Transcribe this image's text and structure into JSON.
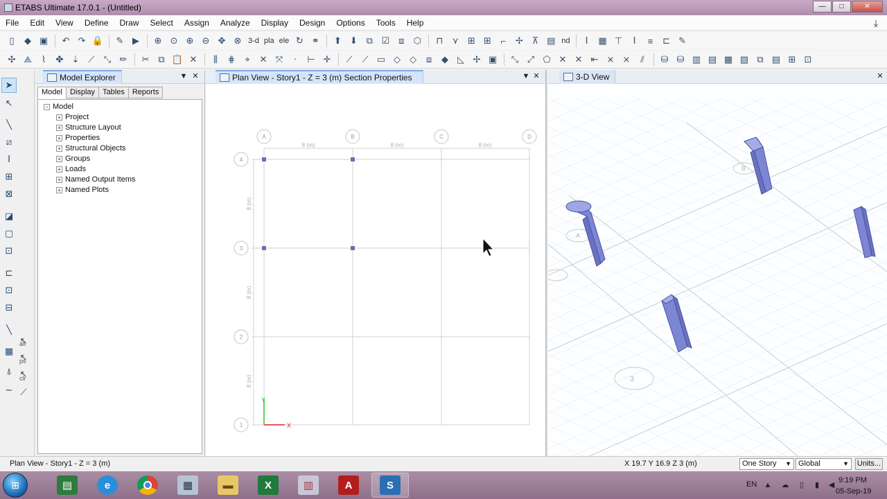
{
  "window": {
    "title": "ETABS Ultimate 17.0.1 - (Untitled)",
    "controls": {
      "minimize": "—",
      "maximize": "□",
      "close": "✕"
    }
  },
  "menu": [
    "File",
    "Edit",
    "View",
    "Define",
    "Draw",
    "Select",
    "Assign",
    "Analyze",
    "Display",
    "Design",
    "Options",
    "Tools",
    "Help"
  ],
  "toolbar": {
    "view_3d_label": "3-d",
    "plan_label": "pla",
    "elev_label": "ele",
    "nd_label": "nd"
  },
  "left_tools": {
    "label_all": "all",
    "label_ps": "ps",
    "label_clr": "clr"
  },
  "model_explorer": {
    "title": "Model Explorer",
    "tabs": [
      "Model",
      "Display",
      "Tables",
      "Reports"
    ],
    "root": "Model",
    "items": [
      "Project",
      "Structure Layout",
      "Properties",
      "Structural Objects",
      "Groups",
      "Loads",
      "Named Output Items",
      "Named Plots"
    ]
  },
  "plan_view": {
    "title": "Plan View - Story1 - Z = 3 (m)  Section Properties",
    "grid_x": [
      "A",
      "B",
      "C",
      "D"
    ],
    "grid_y": [
      "4",
      "3",
      "2",
      "1"
    ],
    "spacing_label": "8 (m)",
    "axis_x": "X",
    "axis_y": "Y"
  },
  "view_3d": {
    "title": "3-D View",
    "bubble_a": "A",
    "bubble_b": "B",
    "bubble_3": "3"
  },
  "status": {
    "left": "Plan View - Story1 - Z = 3 (m)",
    "coords": "X 19.7  Y 16.9  Z 3 (m)",
    "story_select": "One Story",
    "coord_select": "Global",
    "units_button": "Units..."
  },
  "taskbar": {
    "lang": "EN",
    "time": "9:19 PM",
    "date": "05-Sep-19",
    "apps": [
      "books-icon",
      "internet-explorer-icon",
      "chrome-icon",
      "calculator-icon",
      "file-explorer-icon",
      "excel-icon",
      "etabs-icon",
      "autocad-icon",
      "safe-icon"
    ]
  }
}
